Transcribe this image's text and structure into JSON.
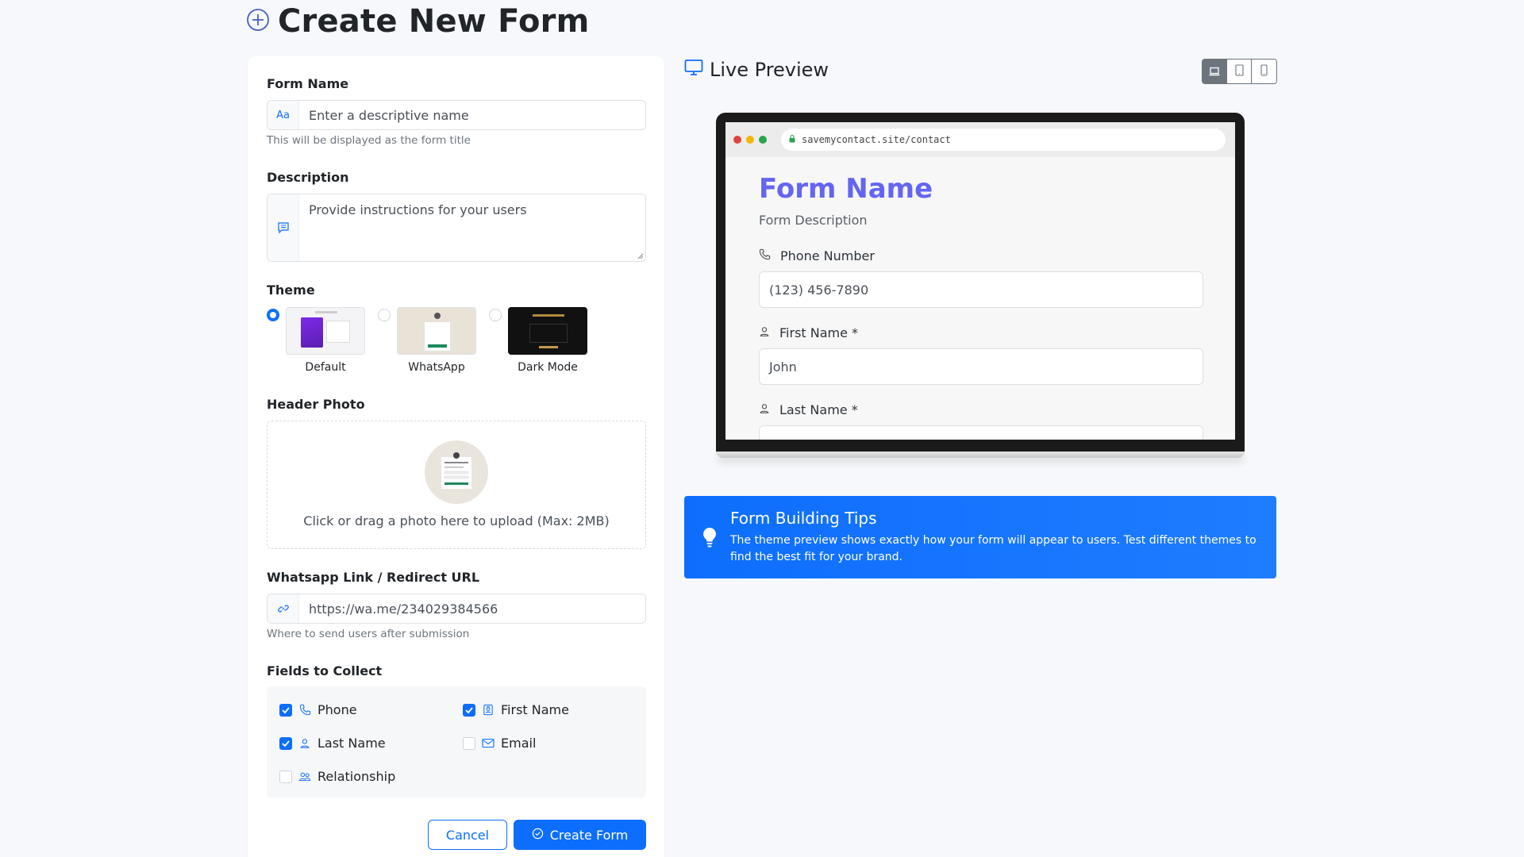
{
  "page": {
    "title": "Create New Form"
  },
  "form": {
    "name_label": "Form Name",
    "name_addon": "Aa",
    "name_placeholder": "Enter a descriptive name",
    "name_help": "This will be displayed as the form title",
    "description_label": "Description",
    "description_placeholder": "Provide instructions for your users",
    "theme_label": "Theme",
    "themes": [
      {
        "name": "Default",
        "selected": true
      },
      {
        "name": "WhatsApp",
        "selected": false
      },
      {
        "name": "Dark Mode",
        "selected": false
      }
    ],
    "header_photo_label": "Header Photo",
    "upload_text": "Click or drag a photo here to upload (Max: 2MB)",
    "redirect_label": "Whatsapp Link / Redirect URL",
    "redirect_value": "https://wa.me/234029384566",
    "redirect_help": "Where to send users after submission",
    "fields_label": "Fields to Collect",
    "fields": [
      {
        "label": "Phone",
        "checked": true,
        "icon": "phone-icon"
      },
      {
        "label": "First Name",
        "checked": true,
        "icon": "badge-icon"
      },
      {
        "label": "Last Name",
        "checked": true,
        "icon": "person-icon"
      },
      {
        "label": "Email",
        "checked": false,
        "icon": "envelope-icon"
      },
      {
        "label": "Relationship",
        "checked": false,
        "icon": "people-icon"
      }
    ],
    "cancel_label": "Cancel",
    "create_label": "Create Form"
  },
  "preview": {
    "title": "Live Preview",
    "devices": [
      "desktop",
      "tablet",
      "mobile"
    ],
    "active_device": "desktop",
    "url": "savemycontact.site/contact",
    "form_title": "Form Name",
    "form_description": "Form Description",
    "fields": [
      {
        "label": "Phone Number",
        "placeholder": "(123) 456-7890",
        "icon": "phone-icon"
      },
      {
        "label": "First Name *",
        "placeholder": "John",
        "icon": "person-icon"
      },
      {
        "label": "Last Name *",
        "placeholder": "",
        "icon": "person-icon"
      }
    ]
  },
  "tips": {
    "title": "Form Building Tips",
    "body": "The theme preview shows exactly how your form will appear to users. Test different themes to find the best fit for your brand."
  },
  "colors": {
    "primary": "#0d6efd",
    "preview_title": "#6366f1"
  }
}
